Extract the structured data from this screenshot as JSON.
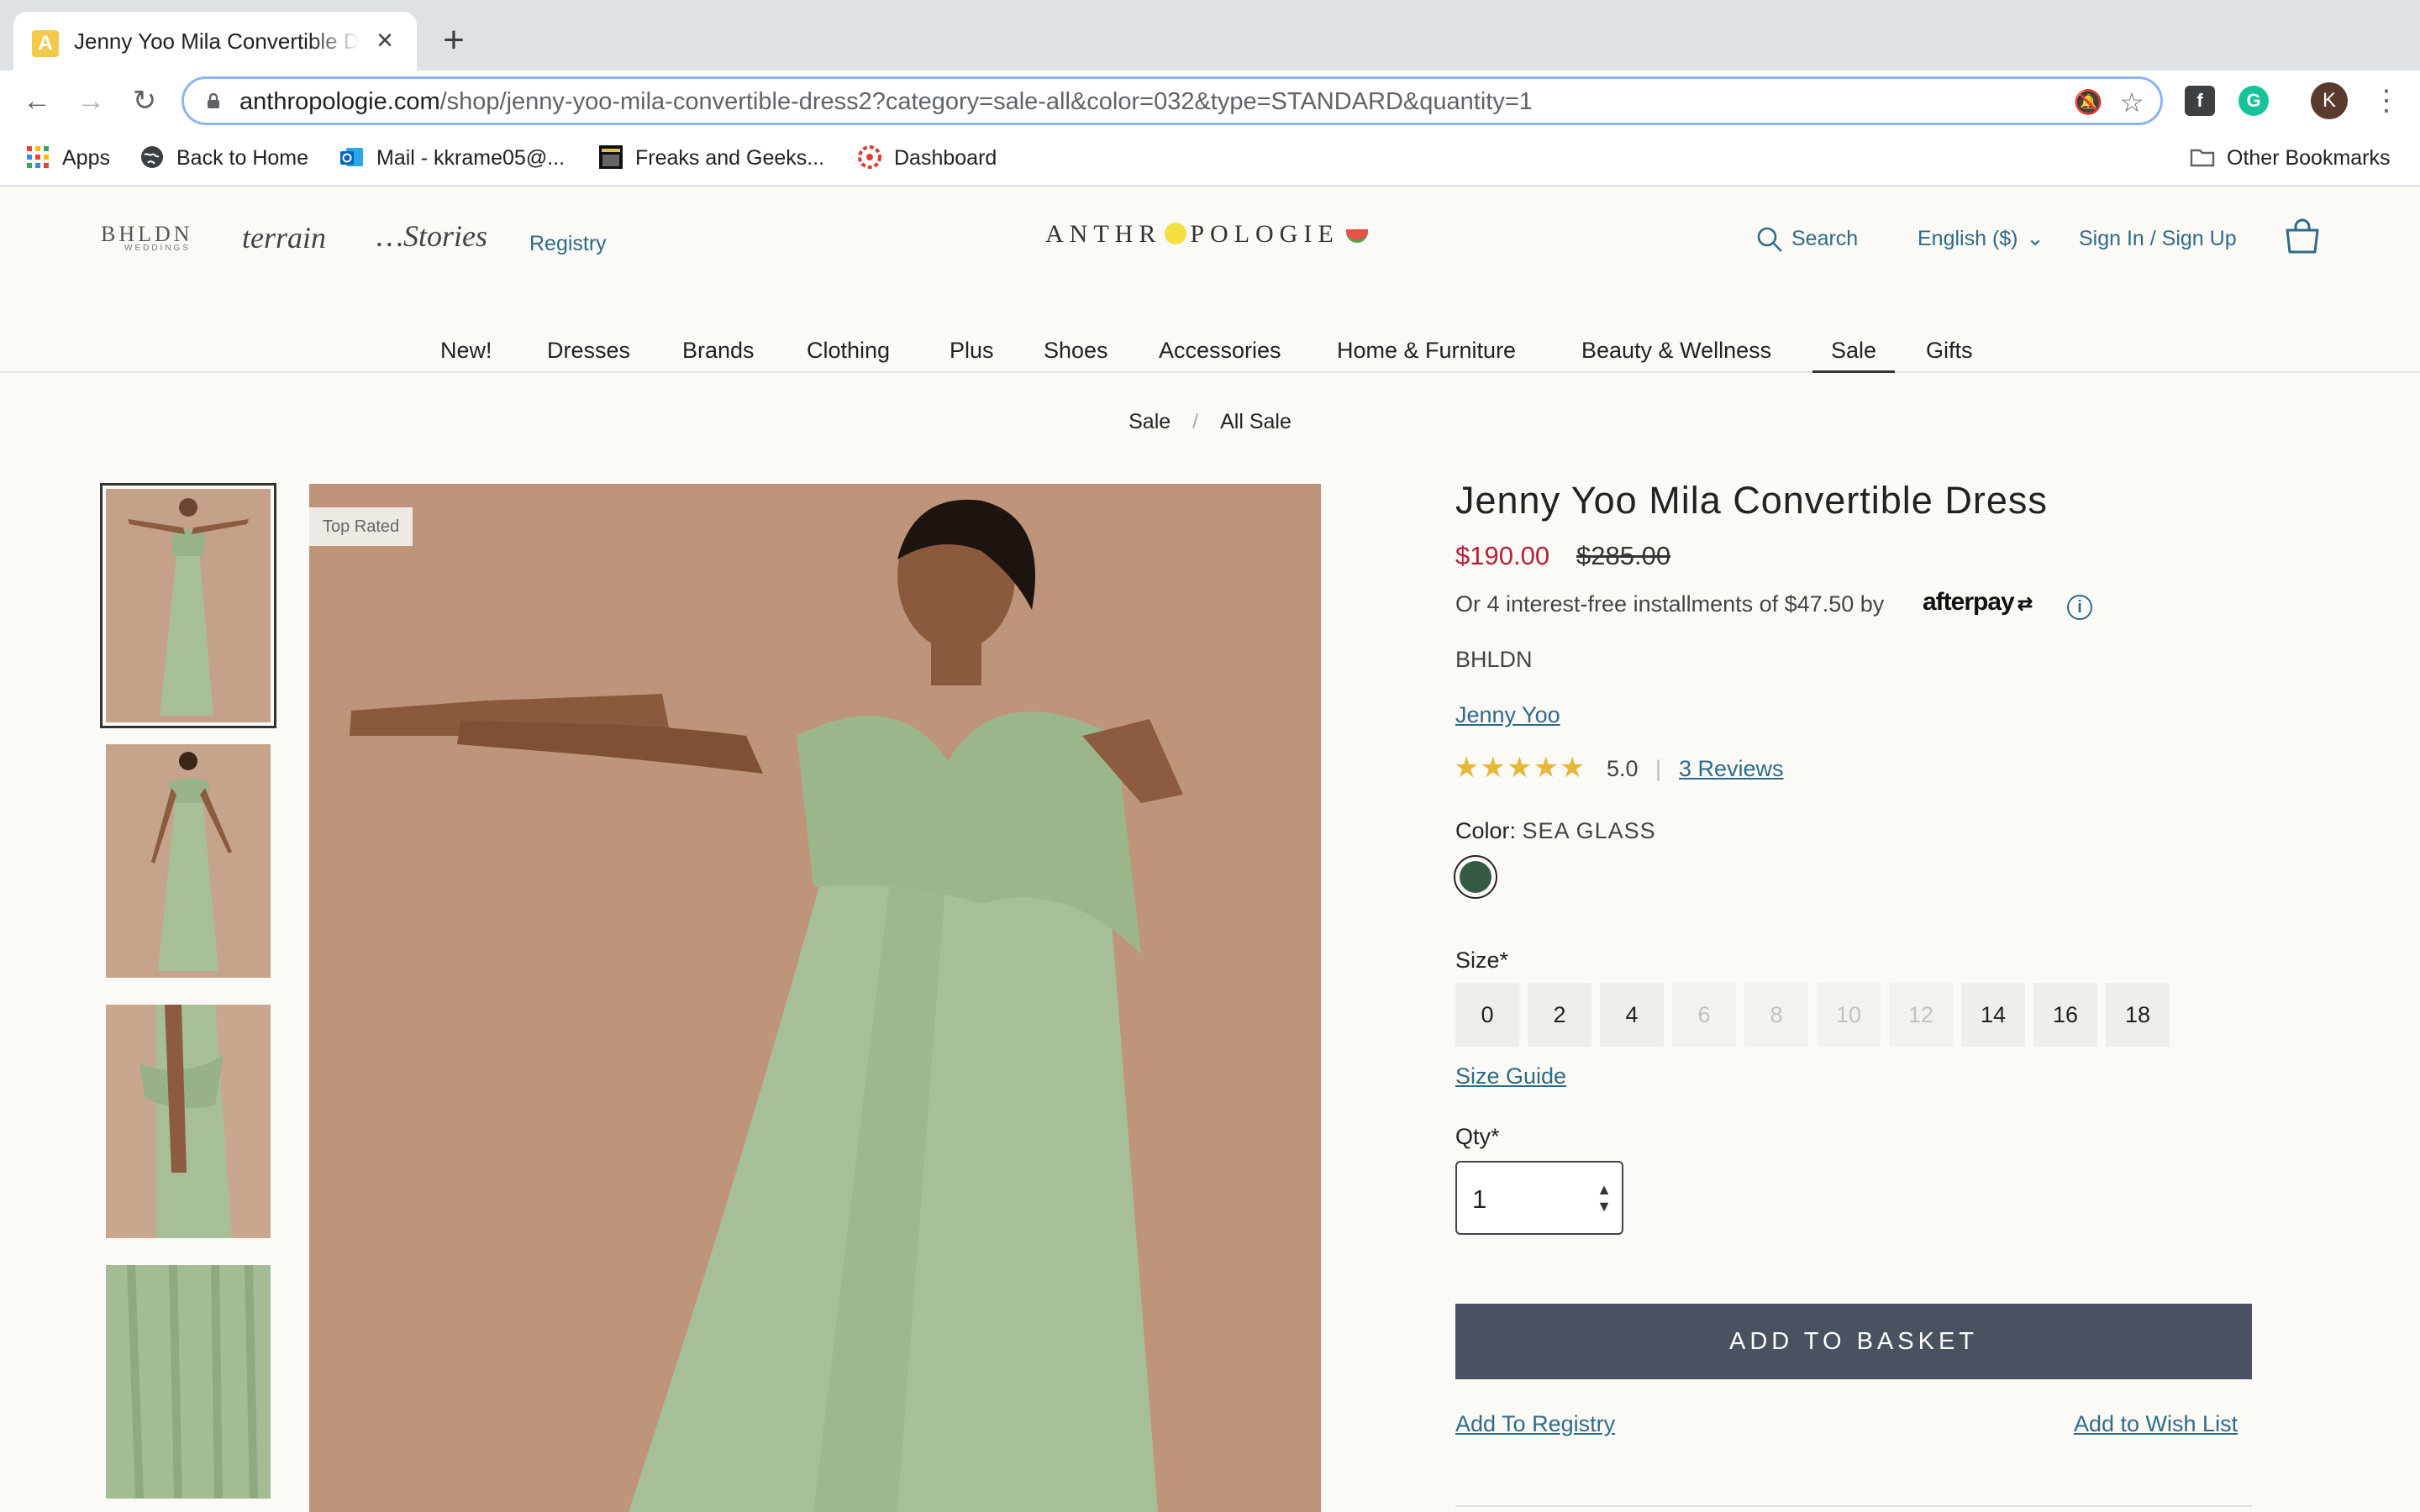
{
  "browser": {
    "tab_title": "Jenny Yoo Mila Convertible Dress | Anthropologie",
    "tab_favicon_letter": "A",
    "url_host": "anthropologie.com",
    "url_path": "/shop/jenny-yoo-mila-convertible-dress2?category=sale-all&color=032&type=STANDARD&quantity=1",
    "avatar_letter": "K",
    "bookmarks": [
      "Apps",
      "Back to Home",
      "Mail - kkrame05@...",
      "Freaks and Geeks...",
      "Dashboard"
    ],
    "other_bookmarks": "Other Bookmarks"
  },
  "header": {
    "bhldn": "BHLDN",
    "bhldn_sub": "WEDDINGS",
    "terrain": "terrain",
    "stories": "…Stories",
    "registry": "Registry",
    "logo_left": "ANTHR",
    "logo_right": "POLOGIE",
    "search": "Search",
    "language": "English ($)",
    "signin": "Sign In / Sign Up"
  },
  "nav": [
    "New!",
    "Dresses",
    "Brands",
    "Clothing",
    "Plus",
    "Shoes",
    "Accessories",
    "Home & Furniture",
    "Beauty & Wellness",
    "Sale",
    "Gifts"
  ],
  "breadcrumb": [
    "Sale",
    "All Sale"
  ],
  "product": {
    "badge": "Top Rated",
    "title": "Jenny Yoo Mila Convertible Dress",
    "price": "$190.00",
    "original_price": "$285.00",
    "installments": "Or 4 interest-free installments of $47.50 by",
    "afterpay": "afterpay",
    "brand": "BHLDN",
    "designer": "Jenny Yoo",
    "stars": "★★★★★",
    "rating": "5.0",
    "rating_sep": "|",
    "reviews": "3 Reviews",
    "color_label": "Color:",
    "color_value": "SEA GLASS",
    "size_label": "Size*",
    "sizes": [
      {
        "label": "0",
        "available": true
      },
      {
        "label": "2",
        "available": true
      },
      {
        "label": "4",
        "available": true
      },
      {
        "label": "6",
        "available": false
      },
      {
        "label": "8",
        "available": false
      },
      {
        "label": "10",
        "available": false
      },
      {
        "label": "12",
        "available": false
      },
      {
        "label": "14",
        "available": true
      },
      {
        "label": "16",
        "available": true
      },
      {
        "label": "18",
        "available": true
      }
    ],
    "size_guide": "Size Guide",
    "qty_label": "Qty*",
    "qty": "1",
    "add_to_basket": "ADD TO BASKET",
    "add_to_registry": "Add To Registry",
    "add_to_wishlist": "Add to Wish List"
  },
  "colors": {
    "accent_link": "#2e6b88",
    "sale_price": "#b0233a",
    "basket_button": "#4a5261",
    "swatch": "#355b45",
    "dress": "#a7bf97",
    "backdrop": "#c39a80"
  }
}
